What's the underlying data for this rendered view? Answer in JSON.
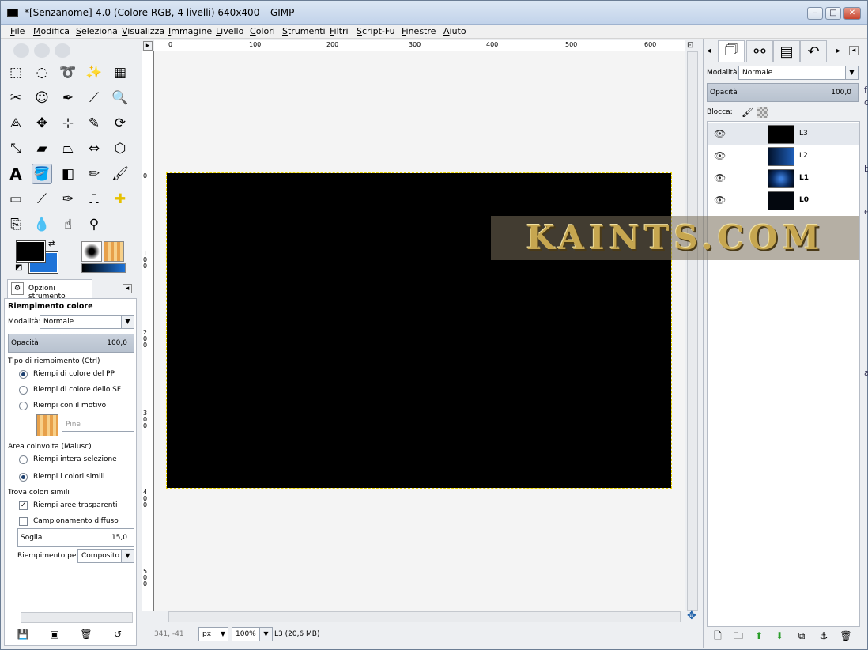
{
  "window": {
    "title": "*[Senzanome]-4.0 (Colore RGB, 4 livelli) 640x400 – GIMP",
    "min": "–",
    "max": "□",
    "close": "✕"
  },
  "menu": [
    "File",
    "Modifica",
    "Seleziona",
    "Visualizza",
    "Immagine",
    "Livello",
    "Colori",
    "Strumenti",
    "Filtri",
    "Script-Fu",
    "Finestre",
    "Aiuto"
  ],
  "tool_options": {
    "tab_label": "Opzioni strumento",
    "heading": "Riempimento colore",
    "mode_label": "Modalità:",
    "mode_value": "Normale",
    "opacity_label": "Opacità",
    "opacity_value": "100,0",
    "fill_type_label": "Tipo di riempimento (Ctrl)",
    "fill_fg": "Riempi di colore del PP",
    "fill_bg": "Riempi di colore dello SF",
    "fill_pattern": "Riempi con il motivo",
    "pattern_name": "Pine",
    "area_label": "Area coinvolta  (Maiusc)",
    "area_selection": "Riempi intera selezione",
    "area_similar": "Riempi i colori simili",
    "find_label": "Trova colori simili",
    "fill_transparent": "Riempi aree trasparenti",
    "sample_merged": "Campionamento diffuso",
    "threshold_label": "Soglia",
    "threshold_value": "15,0",
    "fill_by_label": "Riempimento per:",
    "fill_by_value": "Composito"
  },
  "ruler": {
    "h": [
      "0",
      "100",
      "200",
      "300",
      "400",
      "500",
      "600"
    ],
    "v": [
      "0",
      "100",
      "200",
      "300",
      "400",
      "500"
    ]
  },
  "status": {
    "coords": "341, -41",
    "unit": "px",
    "zoom": "100%",
    "info": "L3 (20,6 MB)"
  },
  "watermark": "KAINTS.COM",
  "layers_panel": {
    "mode_label": "Modalità:",
    "mode_value": "Normale",
    "opacity_label": "Opacità",
    "opacity_value": "100,0",
    "lock_label": "Blocca:",
    "layers": [
      {
        "name": "L3",
        "color": "#000000"
      },
      {
        "name": "L2",
        "color": "#1e5eb8"
      },
      {
        "name": "L1",
        "color": "#0b2e66"
      },
      {
        "name": "L0",
        "color": "#03070e"
      }
    ]
  },
  "side_letters": [
    "f",
    "c",
    "b",
    "e",
    "a"
  ]
}
